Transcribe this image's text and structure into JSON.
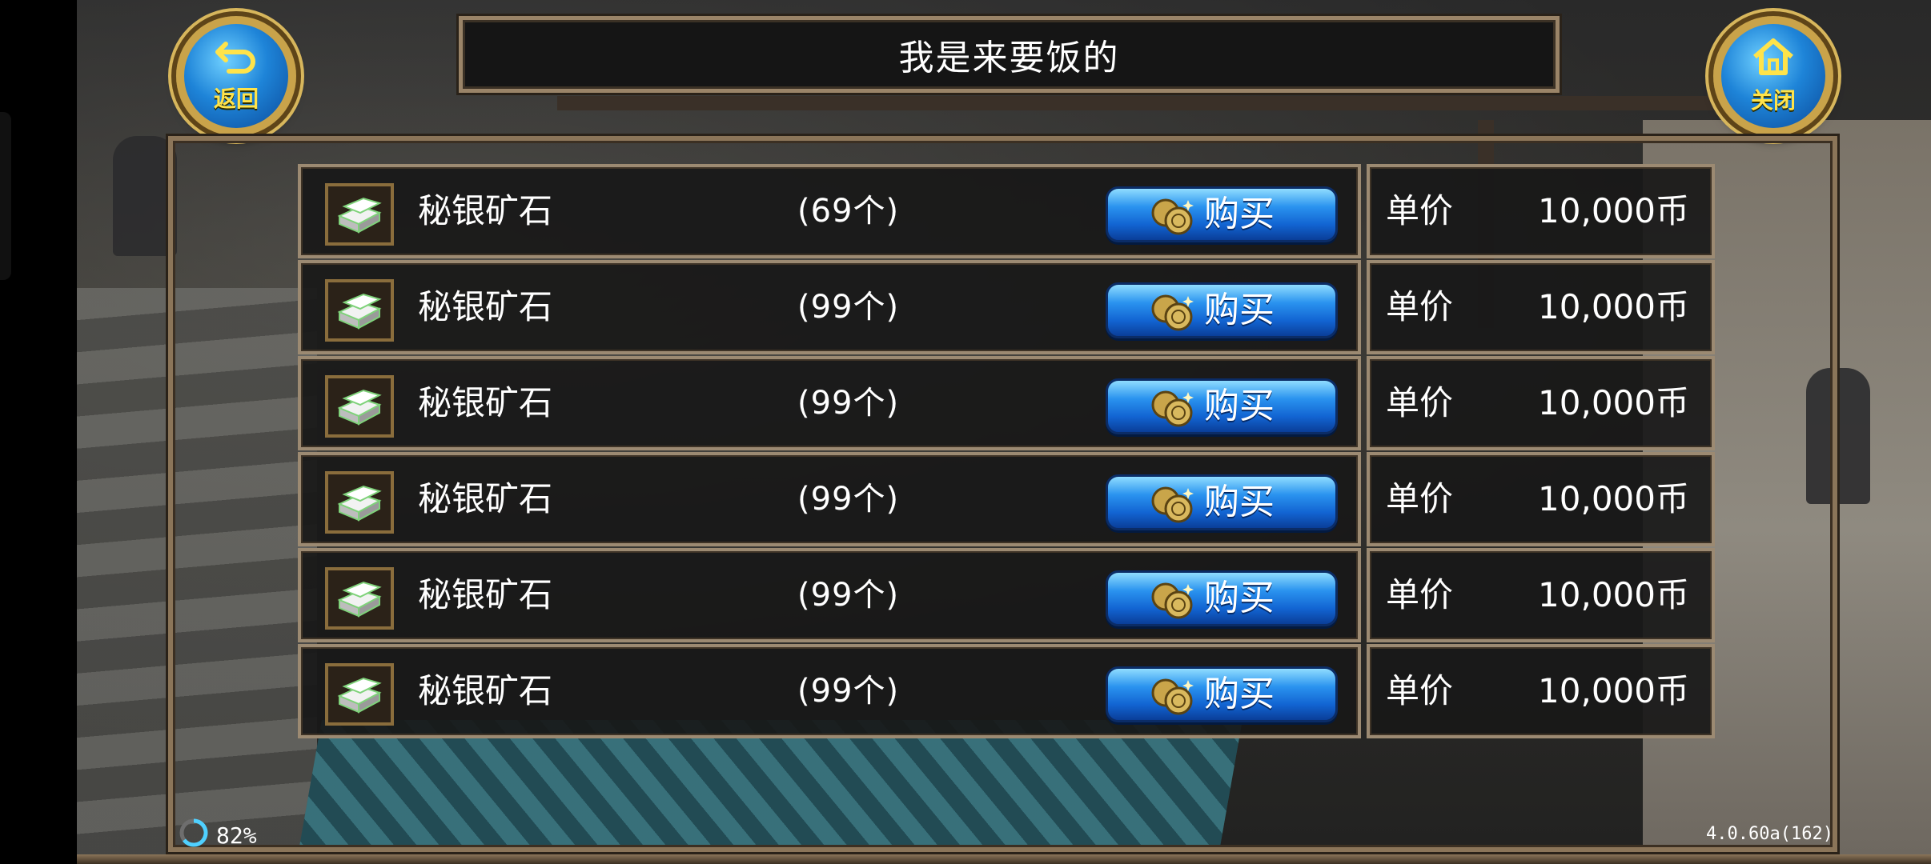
{
  "header": {
    "title": "我是来要饭的",
    "back_label": "返回",
    "close_label": "关闭"
  },
  "items": [
    {
      "name": "秘银矿石",
      "qty": "(69个)",
      "buy_label": "购买",
      "price_label": "单价",
      "price": "10,000币"
    },
    {
      "name": "秘银矿石",
      "qty": "(99个)",
      "buy_label": "购买",
      "price_label": "单价",
      "price": "10,000币"
    },
    {
      "name": "秘银矿石",
      "qty": "(99个)",
      "buy_label": "购买",
      "price_label": "单价",
      "price": "10,000币"
    },
    {
      "name": "秘银矿石",
      "qty": "(99个)",
      "buy_label": "购买",
      "price_label": "单价",
      "price": "10,000币"
    },
    {
      "name": "秘银矿石",
      "qty": "(99个)",
      "buy_label": "购买",
      "price_label": "单价",
      "price": "10,000币"
    },
    {
      "name": "秘银矿石",
      "qty": "(99个)",
      "buy_label": "购买",
      "price_label": "单价",
      "price": "10,000币"
    }
  ],
  "footer": {
    "battery": "82%",
    "version": "4.0.60a(162)"
  },
  "colors": {
    "button_blue": "#1e84d8",
    "frame_bronze": "#9c8a72",
    "orb_text": "#ffe34a"
  },
  "icons": {
    "back": "back-arrow-icon",
    "close": "home-icon",
    "item": "silver-ingot-icon",
    "coin": "coin-icon",
    "battery": "battery-ring-icon"
  }
}
